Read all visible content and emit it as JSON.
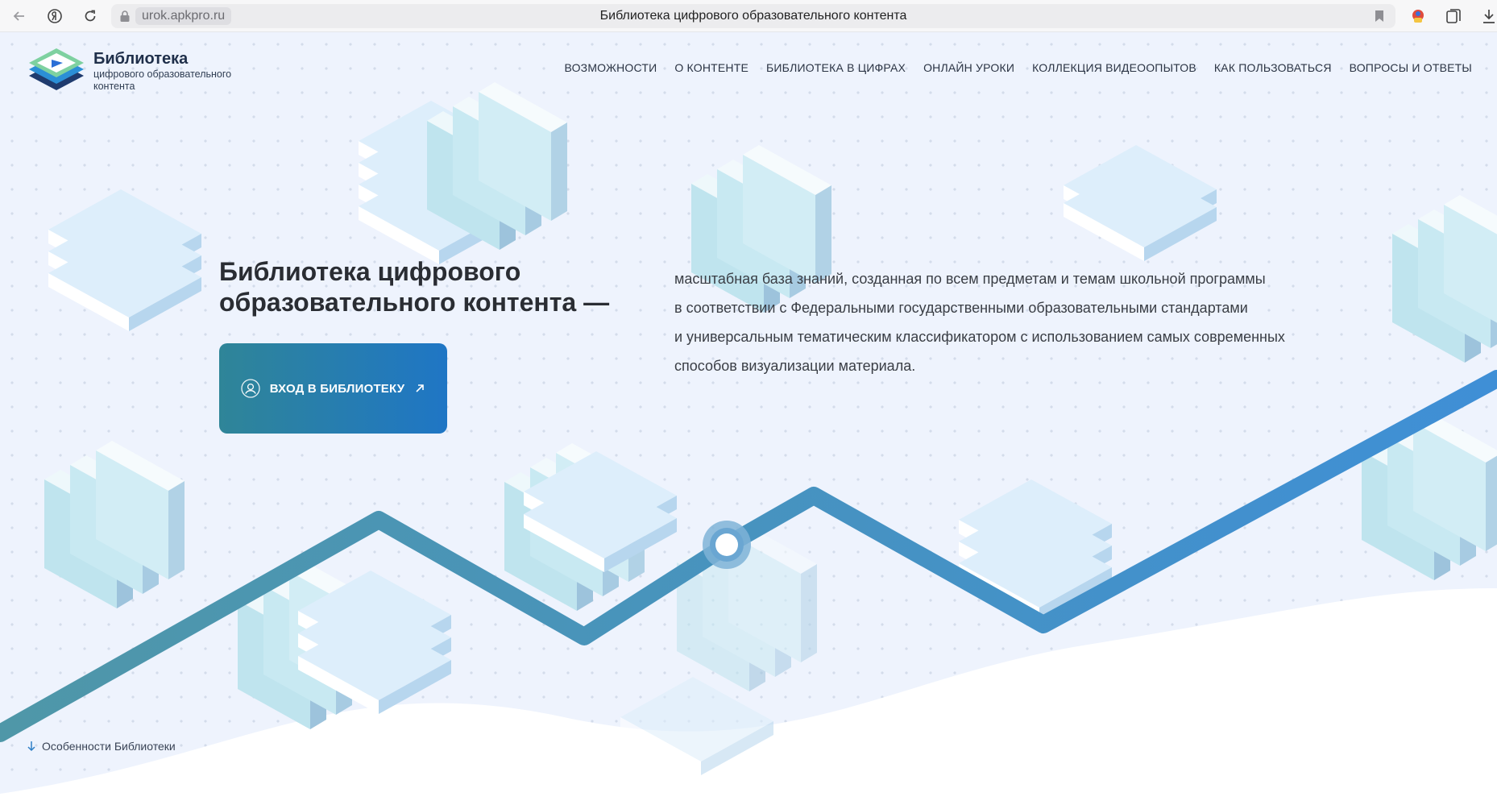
{
  "browser": {
    "url": "urok.apkpro.ru",
    "tab_title": "Библиотека цифрового образовательного контента"
  },
  "brand": {
    "title": "Библиотека",
    "subtitle": "цифрового образовательного контента"
  },
  "nav": {
    "items": [
      "ВОЗМОЖНОСТИ",
      "О КОНТЕНТЕ",
      "БИБЛИОТЕКА В ЦИФРАХ",
      "ОНЛАЙН УРОКИ",
      "КОЛЛЕКЦИЯ ВИДЕООПЫТОВ",
      "КАК ПОЛЬЗОВАТЬСЯ",
      "ВОПРОСЫ И ОТВЕТЫ"
    ]
  },
  "hero": {
    "title": "Библиотека цифрового образовательного контента —",
    "description_lines": [
      "масштабная база знаний, созданная по всем предметам и темам школьной программы",
      "в соответствии с Федеральными государственными образовательными стандартами",
      "и универсальным тематическим классификатором с использованием самых современных",
      "способов визуализации материала."
    ],
    "cta_label": "ВХОД В БИБЛИОТЕКУ"
  },
  "footer_link": "Особенности Библиотеки",
  "colors": {
    "page_bg": "#eef3fd",
    "cta_start": "#2f8598",
    "cta_end": "#1f76c5",
    "path_start": "#4f97a8",
    "path_end": "#3f8fd6"
  },
  "icons": {
    "back": "arrow-left-icon",
    "yandex": "yandex-icon",
    "reload": "reload-icon",
    "lock": "lock-icon",
    "bookmark": "bookmark-icon",
    "user": "user-icon",
    "external": "arrow-up-right-icon",
    "scroll": "arrow-down-icon"
  }
}
